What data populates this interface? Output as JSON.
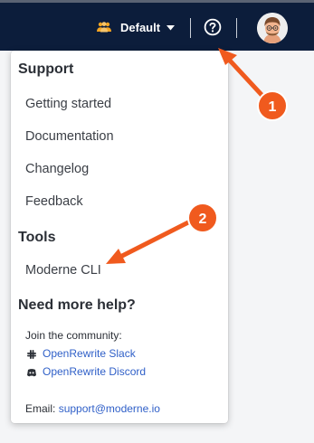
{
  "header": {
    "org_label": "Default"
  },
  "menu": {
    "support_title": "Support",
    "support_items": [
      "Getting started",
      "Documentation",
      "Changelog",
      "Feedback"
    ],
    "tools_title": "Tools",
    "tools_items": [
      "Moderne CLI"
    ],
    "help_title": "Need more help?",
    "community_label": "Join the community:",
    "community_links": [
      {
        "label": "OpenRewrite Slack",
        "icon": "slack-icon"
      },
      {
        "label": "OpenRewrite Discord",
        "icon": "discord-icon"
      }
    ],
    "email_label": "Email:",
    "email_address": "support@moderne.io"
  },
  "annotations": {
    "badges": [
      "1",
      "2"
    ],
    "color": "#f05a1e"
  },
  "colors": {
    "topbar": "#0c1d3b",
    "link": "#3060c8",
    "org_icon": "#f5a623"
  }
}
